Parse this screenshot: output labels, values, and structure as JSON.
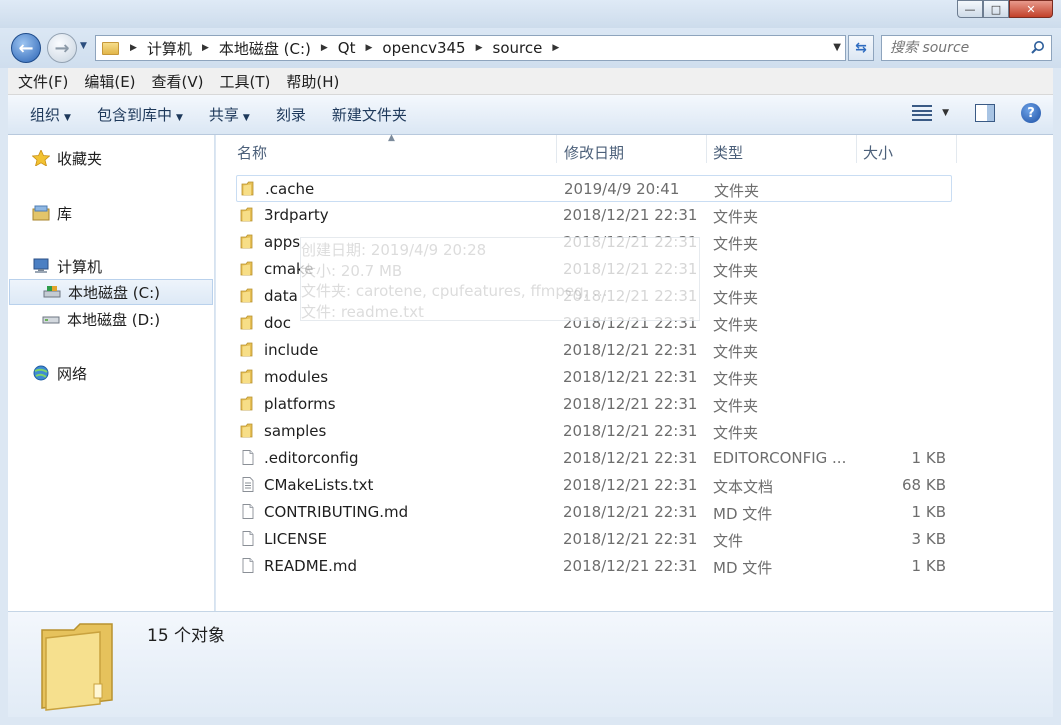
{
  "window": {
    "minimize_glyph": "—",
    "maximize_glyph": "□",
    "close_glyph": "✕"
  },
  "address": {
    "back_glyph": "←",
    "forward_glyph": "→",
    "breadcrumbs": [
      "计算机",
      "本地磁盘 (C:)",
      "Qt",
      "opencv345",
      "source"
    ],
    "refresh_glyph": "⇆"
  },
  "search": {
    "placeholder": "搜索 source"
  },
  "menu": {
    "items": [
      "文件(F)",
      "编辑(E)",
      "查看(V)",
      "工具(T)",
      "帮助(H)"
    ]
  },
  "toolbar": {
    "organize": "组织",
    "include_in_library": "包含到库中",
    "share": "共享",
    "burn": "刻录",
    "new_folder": "新建文件夹",
    "help_glyph": "?"
  },
  "nav": {
    "favorites": "收藏夹",
    "libraries": "库",
    "computer": "计算机",
    "drive_c": "本地磁盘 (C:)",
    "drive_d": "本地磁盘 (D:)",
    "network": "网络"
  },
  "columns": {
    "name": "名称",
    "date": "修改日期",
    "type": "类型",
    "size": "大小"
  },
  "files": [
    {
      "name": ".cache",
      "date": "2019/4/9 20:41",
      "type": "文件夹",
      "size": "",
      "kind": "folder"
    },
    {
      "name": "3rdparty",
      "date": "2018/12/21 22:31",
      "type": "文件夹",
      "size": "",
      "kind": "folder"
    },
    {
      "name": "apps",
      "date": "2018/12/21 22:31",
      "type": "文件夹",
      "size": "",
      "kind": "folder"
    },
    {
      "name": "cmake",
      "date": "2018/12/21 22:31",
      "type": "文件夹",
      "size": "",
      "kind": "folder"
    },
    {
      "name": "data",
      "date": "2018/12/21 22:31",
      "type": "文件夹",
      "size": "",
      "kind": "folder"
    },
    {
      "name": "doc",
      "date": "2018/12/21 22:31",
      "type": "文件夹",
      "size": "",
      "kind": "folder"
    },
    {
      "name": "include",
      "date": "2018/12/21 22:31",
      "type": "文件夹",
      "size": "",
      "kind": "folder"
    },
    {
      "name": "modules",
      "date": "2018/12/21 22:31",
      "type": "文件夹",
      "size": "",
      "kind": "folder"
    },
    {
      "name": "platforms",
      "date": "2018/12/21 22:31",
      "type": "文件夹",
      "size": "",
      "kind": "folder"
    },
    {
      "name": "samples",
      "date": "2018/12/21 22:31",
      "type": "文件夹",
      "size": "",
      "kind": "folder"
    },
    {
      "name": ".editorconfig",
      "date": "2018/12/21 22:31",
      "type": "EDITORCONFIG ...",
      "size": "1 KB",
      "kind": "file"
    },
    {
      "name": "CMakeLists.txt",
      "date": "2018/12/21 22:31",
      "type": "文本文档",
      "size": "68 KB",
      "kind": "text"
    },
    {
      "name": "CONTRIBUTING.md",
      "date": "2018/12/21 22:31",
      "type": "MD 文件",
      "size": "1 KB",
      "kind": "file"
    },
    {
      "name": "LICENSE",
      "date": "2018/12/21 22:31",
      "type": "文件",
      "size": "3 KB",
      "kind": "file"
    },
    {
      "name": "README.md",
      "date": "2018/12/21 22:31",
      "type": "MD 文件",
      "size": "1 KB",
      "kind": "file"
    }
  ],
  "tooltip": {
    "lines": [
      "创建日期: 2019/4/9 20:28",
      "大小: 20.7 MB",
      "文件夹: carotene, cpufeatures, ffmpeg, ...",
      "文件: readme.txt"
    ]
  },
  "status": {
    "count_text": "15 个对象"
  },
  "colors": {
    "accent": "#3b73b9",
    "folder_yellow": "#e9c463",
    "window_chrome": "#dce7f3"
  }
}
